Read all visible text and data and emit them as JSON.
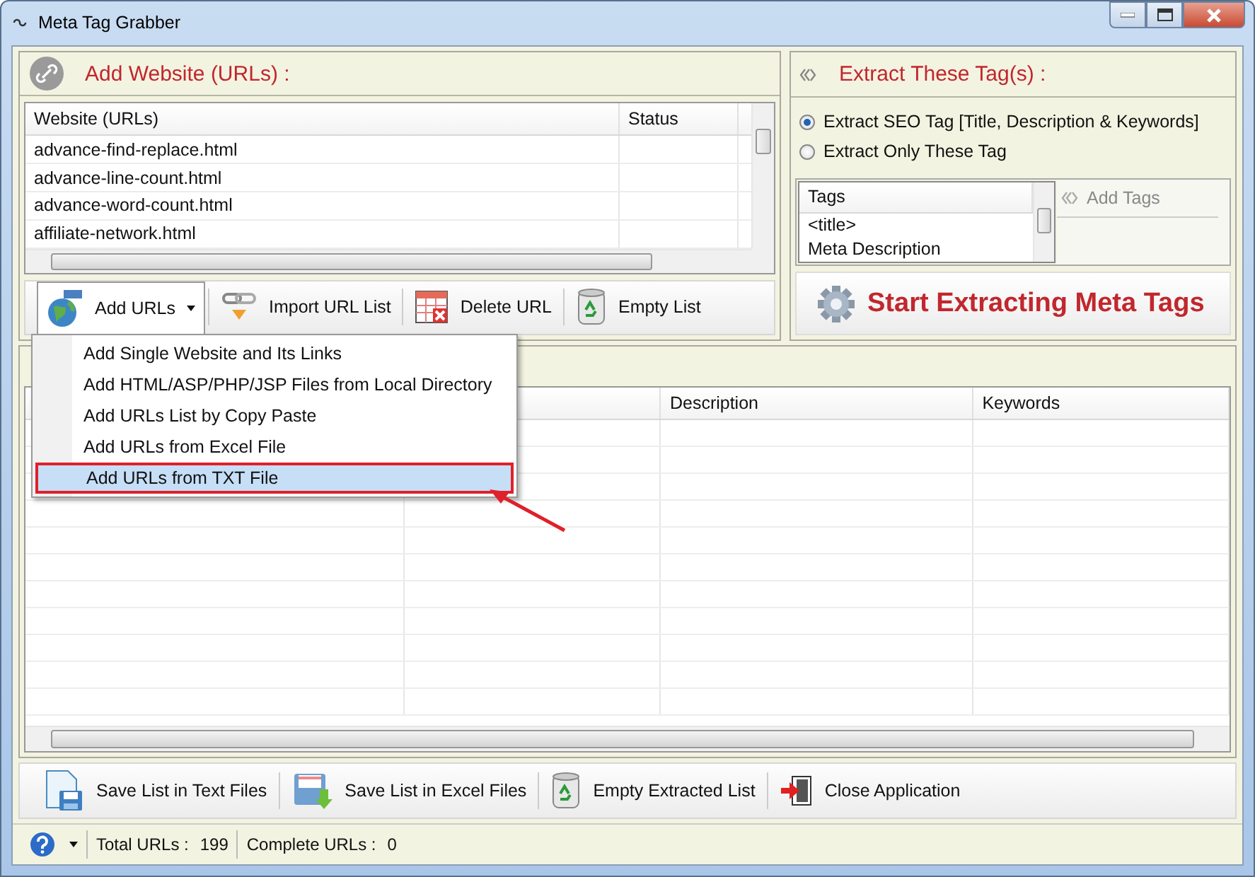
{
  "window": {
    "title": "Meta Tag Grabber"
  },
  "url_panel": {
    "title": "Add Website (URLs) :",
    "columns": [
      "Website (URLs)",
      "Status"
    ],
    "rows": [
      "advance-find-replace.html",
      "advance-line-count.html",
      "advance-word-count.html",
      "affiliate-network.html"
    ]
  },
  "url_toolbar": [
    {
      "label": "Add URLs",
      "kind": "dropdown",
      "expanded": true
    },
    {
      "label": "Import URL List",
      "kind": "import"
    },
    {
      "label": "Delete URL",
      "kind": "delete"
    },
    {
      "label": "Empty List",
      "kind": "recycle"
    }
  ],
  "add_urls_menu": [
    {
      "label": "Add Single Website and Its Links",
      "selected": false
    },
    {
      "label": "Add HTML/ASP/PHP/JSP Files from Local Directory",
      "selected": false
    },
    {
      "label": "Add URLs List by Copy Paste",
      "selected": false
    },
    {
      "label": "Add URLs from Excel File",
      "selected": false
    },
    {
      "label": "Add URLs from TXT File",
      "selected": true
    }
  ],
  "tags_panel": {
    "title": "Extract These Tag(s) :",
    "options": [
      {
        "label": "Extract SEO Tag [Title, Description & Keywords]",
        "selected": true
      },
      {
        "label": "Extract Only These Tag",
        "selected": false
      }
    ],
    "tags_column": "Tags",
    "tags": [
      "<title>",
      "Meta Description"
    ],
    "add_tags": "Add Tags",
    "start_button": "Start Extracting Meta Tags"
  },
  "results_table": {
    "columns": [
      "Description",
      "Keywords"
    ]
  },
  "bottom_toolbar": [
    {
      "label": "Save List in Text Files",
      "kind": "text-file"
    },
    {
      "label": "Save List in Excel Files",
      "kind": "excel-file"
    },
    {
      "label": "Empty Extracted List",
      "kind": "recycle"
    },
    {
      "label": "Close Application",
      "kind": "exit"
    }
  ],
  "status_bar": {
    "total_label": "Total URLs :",
    "total": "199",
    "complete_label": "Complete URLs :",
    "complete": "0"
  }
}
